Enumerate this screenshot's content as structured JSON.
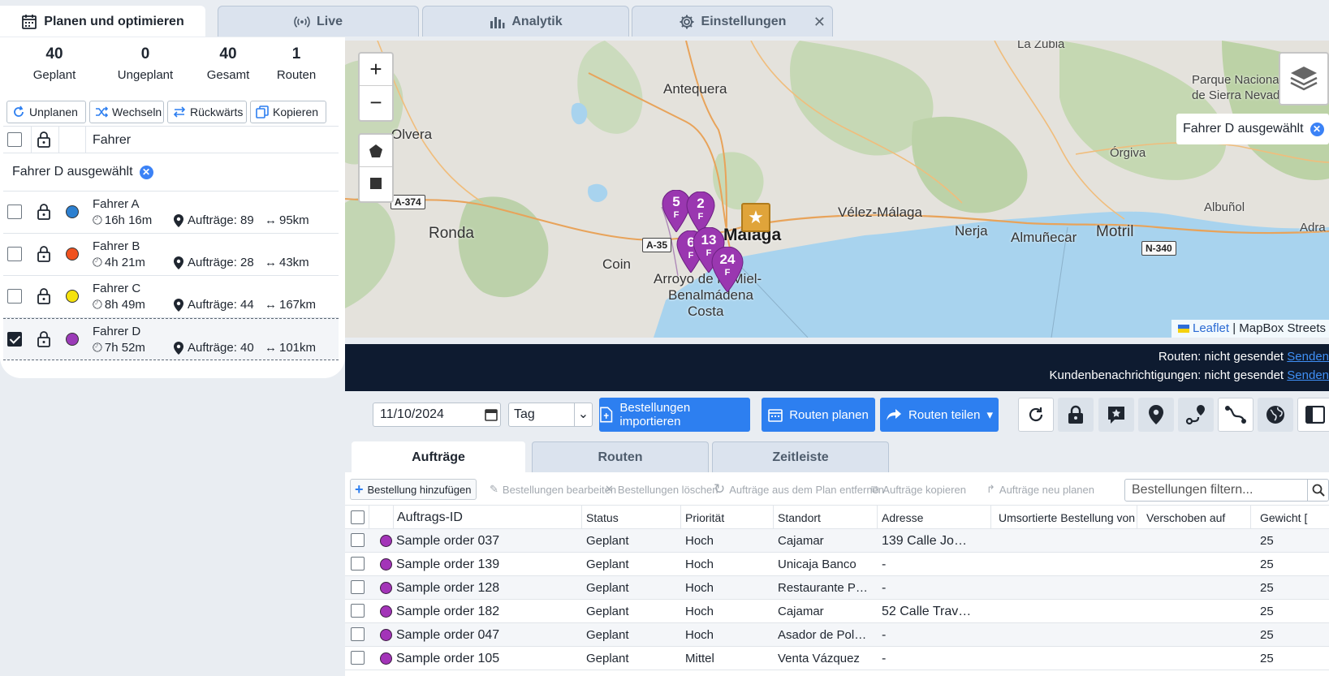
{
  "top_tabs": [
    {
      "label": "Planen und optimieren",
      "icon": "calendar-icon"
    },
    {
      "label": "Live",
      "icon": "broadcast-icon"
    },
    {
      "label": "Analytik",
      "icon": "bar-chart-icon"
    },
    {
      "label": "Einstellungen",
      "icon": "gear-icon"
    }
  ],
  "stats": [
    {
      "value": "40",
      "label": "Geplant"
    },
    {
      "value": "0",
      "label": "Ungeplant"
    },
    {
      "value": "40",
      "label": "Gesamt"
    },
    {
      "value": "1",
      "label": "Routen"
    }
  ],
  "actions": {
    "unplan": "Unplanen",
    "switch": "Wechseln",
    "reverse": "Rückwärts",
    "copy": "Kopieren"
  },
  "driver_header": "Fahrer",
  "selected_banner": "Fahrer D ausgewählt",
  "drivers": [
    {
      "name": "Fahrer A",
      "duration": "16h 16m",
      "orders": "Aufträge: 89",
      "distance": "95km",
      "color": "#2d80d0",
      "checked": false
    },
    {
      "name": "Fahrer B",
      "duration": "4h 21m",
      "orders": "Aufträge: 28",
      "distance": "43km",
      "color": "#f0521f",
      "checked": false
    },
    {
      "name": "Fahrer C",
      "duration": "8h 49m",
      "orders": "Aufträge: 44",
      "distance": "167km",
      "color": "#f5e20d",
      "checked": false
    },
    {
      "name": "Fahrer D",
      "duration": "7h 52m",
      "orders": "Aufträge: 40",
      "distance": "101km",
      "color": "#9b3bb8",
      "checked": true
    }
  ],
  "map": {
    "labels": {
      "la_zubia": "La Zubia",
      "antequera": "Antequera",
      "olvera": "Olvera",
      "ronda": "Ronda",
      "velez": "Vélez-Málaga",
      "nerja": "Nerja",
      "almunecar": "Almuñecar",
      "motril": "Motril",
      "albunol": "Albuñol",
      "orgiva": "Órgiva",
      "adra": "Adra",
      "coin": "Coin",
      "malaga": "Málaga",
      "arroyo": "Arroyo de la Miel-",
      "benalmadena": "Benalmádena",
      "costa": "Costa",
      "parque1": "Parque Nacional",
      "parque2": "de Sierra Nevada"
    },
    "roads": {
      "a374": "A-374",
      "a35": "A-35",
      "n340": "N-340"
    },
    "markers": [
      "5",
      "2",
      "6",
      "13",
      "24"
    ],
    "marker_sub": "F",
    "zoom_in": "+",
    "zoom_out": "−",
    "selected_chip": "Fahrer D ausgewählt",
    "attribution_leaflet": "Leaflet",
    "attribution_rest": " | MapBox Streets"
  },
  "status": {
    "routes_label": "Routen:",
    "routes_value": "nicht gesendet",
    "notify_label": "Kundenbenachrichtigungen:",
    "notify_value": "nicht gesendet",
    "send": "Senden"
  },
  "toolbar": {
    "date": "11/10/2024",
    "period": "Tag",
    "import": "Bestellungen importieren",
    "plan": "Routen planen",
    "share": "Routen teilen"
  },
  "sub_tabs": [
    "Aufträge",
    "Routen",
    "Zeitleiste"
  ],
  "order_tools": {
    "add": "Bestellung hinzufügen",
    "edit": "Bestellungen bearbeiten",
    "delete": "Bestellungen löschen",
    "remove": "Aufträge aus dem Plan entfernen",
    "copy": "Aufträge kopieren",
    "replan": "Aufträge neu planen",
    "filter_placeholder": "Bestellungen filtern..."
  },
  "columns": [
    "Auftrags-ID",
    "Status",
    "Priorität",
    "Standort",
    "Adresse",
    "Umsortierte Bestellung von",
    "Verschoben auf",
    "Gewicht ["
  ],
  "orders": [
    {
      "id": "Sample order 037",
      "status": "Geplant",
      "priority": "Hoch",
      "location": "Cajamar",
      "address": "139 Calle Jo…",
      "weight": "25"
    },
    {
      "id": "Sample order 139",
      "status": "Geplant",
      "priority": "Hoch",
      "location": "Unicaja Banco",
      "address": "-",
      "weight": "25"
    },
    {
      "id": "Sample order 128",
      "status": "Geplant",
      "priority": "Hoch",
      "location": "Restaurante P…",
      "address": "-",
      "weight": "25"
    },
    {
      "id": "Sample order 182",
      "status": "Geplant",
      "priority": "Hoch",
      "location": "Cajamar",
      "address": "52 Calle Trav…",
      "weight": "25"
    },
    {
      "id": "Sample order 047",
      "status": "Geplant",
      "priority": "Hoch",
      "location": "Asador de Pol…",
      "address": "-",
      "weight": "25"
    },
    {
      "id": "Sample order 105",
      "status": "Geplant",
      "priority": "Mittel",
      "location": "Venta Vázquez",
      "address": "-",
      "weight": "25"
    }
  ]
}
